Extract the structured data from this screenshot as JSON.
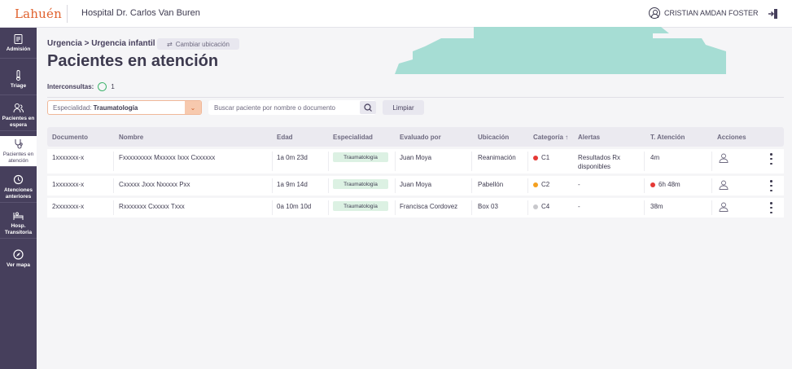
{
  "header": {
    "logo": "Lahuén",
    "hospital": "Hospital Dr. Carlos Van Buren",
    "user_name": "CRISTIAN AMDAN FOSTER"
  },
  "sidebar": {
    "items": [
      {
        "label": "Admisión",
        "icon": "clipboard-icon",
        "active": false
      },
      {
        "label": "Triage",
        "icon": "thermometer-icon",
        "active": false
      },
      {
        "label": "Pacientes en espera",
        "icon": "patients-waiting-icon",
        "active": false
      },
      {
        "label": "Pacientes en atención",
        "icon": "stethoscope-icon",
        "active": true
      },
      {
        "label": "Atenciones anteriores",
        "icon": "history-icon",
        "active": false
      },
      {
        "label": "Hosp. Transitoria",
        "icon": "bed-icon",
        "active": false
      },
      {
        "label": "Ver mapa",
        "icon": "compass-icon",
        "active": false
      }
    ]
  },
  "main": {
    "breadcrumb": "Urgencia > Urgencia infantil",
    "change_location": "Cambiar ubicación",
    "title": "Pacientes en atención",
    "interconsultas_label": "Interconsultas:",
    "interconsultas_count": "1",
    "filters": {
      "specialty_label": "Especialidad:",
      "specialty_value": "Traumatología",
      "search_placeholder": "Buscar paciente por nombre o documento",
      "clear_label": "Limpiar"
    }
  },
  "table": {
    "headers": [
      "Documento",
      "Nombre",
      "Edad",
      "Especialidad",
      "Evaluado por",
      "Ubicación",
      "Categoría ↑",
      "Alertas",
      "T. Atención",
      "Acciones"
    ],
    "rows": [
      {
        "documento": "1xxxxxxx-x",
        "nombre": "Fxxxxxxxxx Mxxxxx Ixxx Cxxxxxx",
        "edad": "1a 0m 23d",
        "especialidad": "Traumatología",
        "evaluado": "Juan Moya",
        "ubicacion": "Reanimación",
        "categoria": "C1",
        "categoria_color": "#e53935",
        "alertas": "Resultados Rx disponibles",
        "tiempo": "4m",
        "tiempo_alert": false
      },
      {
        "documento": "1xxxxxxx-x",
        "nombre": "Cxxxxx Jxxx Nxxxxx Pxx",
        "edad": "1a 9m 14d",
        "especialidad": "Traumatología",
        "evaluado": "Juan Moya",
        "ubicacion": "Pabellón",
        "categoria": "C2",
        "categoria_color": "#f4a020",
        "alertas": "-",
        "tiempo": "6h 48m",
        "tiempo_alert": true
      },
      {
        "documento": "2xxxxxxx-x",
        "nombre": "Rxxxxxxx Cxxxxx Txxx",
        "edad": "0a 10m 10d",
        "especialidad": "Traumatología",
        "evaluado": "Francisca Cordovez",
        "ubicacion": "Box 03",
        "categoria": "C4",
        "categoria_color": "#c8c8cc",
        "alertas": "-",
        "tiempo": "38m",
        "tiempo_alert": false
      }
    ]
  },
  "colors": {
    "sidebar": "#463f5c",
    "accent": "#e0622e",
    "decor": "#a6ddd4",
    "badge": "#dcf1e3",
    "alert_dot": "#e53935"
  }
}
